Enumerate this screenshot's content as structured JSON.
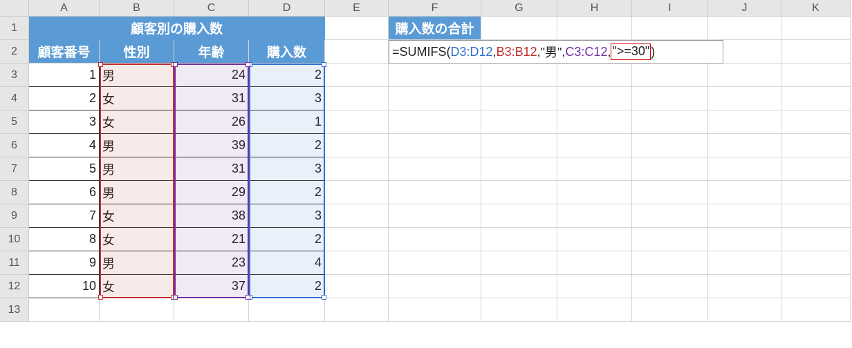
{
  "columns": [
    "A",
    "B",
    "C",
    "D",
    "E",
    "F",
    "G",
    "H",
    "I",
    "J",
    "K"
  ],
  "rows": [
    1,
    2,
    3,
    4,
    5,
    6,
    7,
    8,
    9,
    10,
    11,
    12,
    13
  ],
  "titles": {
    "table_title": "顧客別の購入数",
    "result_title": "購入数の合計"
  },
  "headers": {
    "A": "顧客番号",
    "B": "性別",
    "C": "年齢",
    "D": "購入数"
  },
  "data3": {
    "A": "1",
    "B": "男",
    "C": "24",
    "D": "2"
  },
  "data4": {
    "A": "2",
    "B": "女",
    "C": "31",
    "D": "3"
  },
  "data5": {
    "A": "3",
    "B": "女",
    "C": "26",
    "D": "1"
  },
  "data6": {
    "A": "4",
    "B": "男",
    "C": "39",
    "D": "2"
  },
  "data7": {
    "A": "5",
    "B": "男",
    "C": "31",
    "D": "3"
  },
  "data8": {
    "A": "6",
    "B": "男",
    "C": "29",
    "D": "2"
  },
  "data9": {
    "A": "7",
    "B": "女",
    "C": "38",
    "D": "3"
  },
  "data10": {
    "A": "8",
    "B": "女",
    "C": "21",
    "D": "2"
  },
  "data11": {
    "A": "9",
    "B": "男",
    "C": "23",
    "D": "4"
  },
  "data12": {
    "A": "10",
    "B": "女",
    "C": "37",
    "D": "2"
  },
  "formula": {
    "eq": "=SUMIFS",
    "lp": "(",
    "arg1": "D3:D12",
    "c1": ",",
    "arg2": "B3:B12",
    "c2": ",",
    "arg3": "\"男\"",
    "c3": ",",
    "arg4": "C3:C12",
    "c4": ",",
    "arg5": "\">=30\"",
    "rp": ")"
  }
}
